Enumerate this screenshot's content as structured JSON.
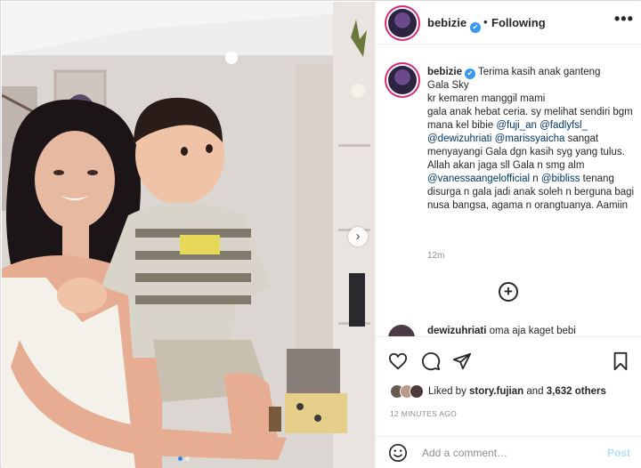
{
  "post": {
    "username": "bebizie",
    "follow_state": "Following",
    "bullet": "•",
    "more_label": "•••",
    "carousel_next": "›"
  },
  "caption": {
    "username": "bebizie",
    "lines": [
      {
        "text": "Terima kasih anak ganteng",
        "inline_first": true
      },
      {
        "text": "Gala Sky"
      },
      {
        "text": "kr kemaren manggil mami"
      }
    ],
    "p1": "gala anak hebat ceria. sy melihat sendiri bgm mana kel bibie ",
    "m1": "@fuji_an",
    "m2": "@fadlyfsl_",
    "m3": "@dewizuhriati",
    "m4": "@marissyaicha",
    "p2": " sangat menyayangi Gala dgn kasih syg yang tulus. Allah akan jaga sll Gala n smg alm ",
    "m5": "@vanessaangelofficial",
    "p3": " n ",
    "m6": "@bibliss",
    "p4": " tenang disurga n gala jadi anak soleh n berguna bagi nusa bangsa, agama n orangtuanya. Aamiin",
    "time_ago": "12m"
  },
  "comments": {
    "load_more_icon": "plus-circle-icon",
    "load_more_symbol": "+",
    "second": {
      "username": "dewizuhriati",
      "text": "oma aja kaget bebi"
    }
  },
  "actions": {
    "liked_by_prefix": "Liked by ",
    "liked_by_user": "story.fujian",
    "liked_by_suffix": " and ",
    "liked_by_count": "3,632 others",
    "timestamp": "12 MINUTES AGO"
  },
  "comment_box": {
    "placeholder": "Add a comment…",
    "post_label": "Post"
  },
  "colors": {
    "story_ring": "#d62976",
    "verified_blue": "#3897f0",
    "mention": "#00376b",
    "post_disabled": "#b2dffc"
  }
}
